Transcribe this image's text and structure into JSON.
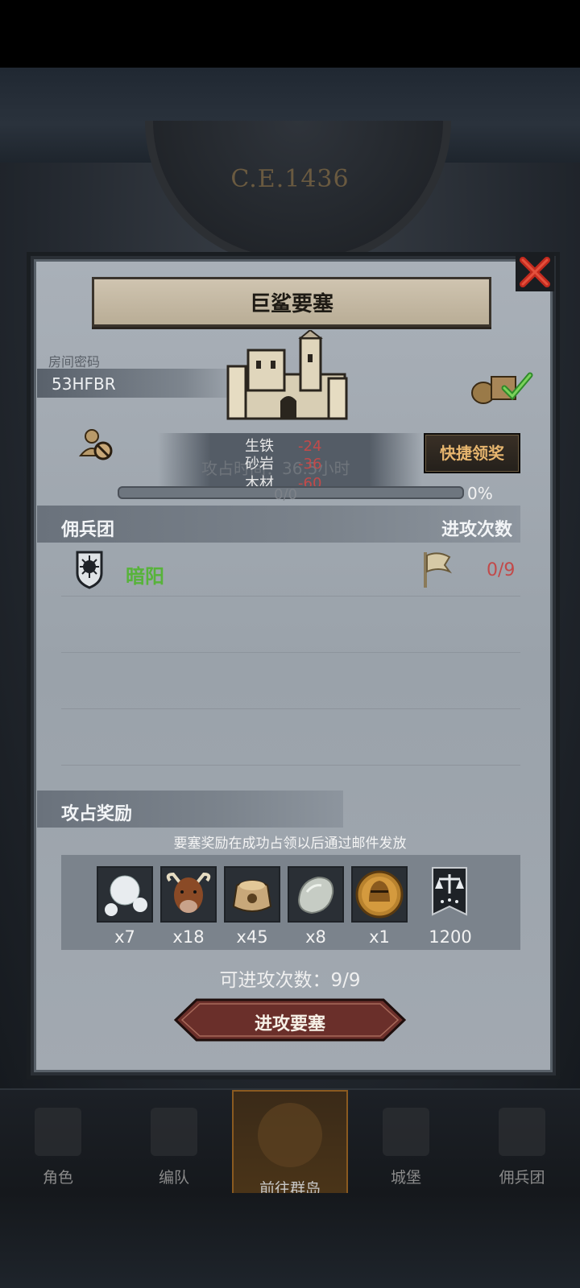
{
  "era_label": "C.E.1436",
  "modal": {
    "title": "巨鲨要塞",
    "room_label": "房间密码",
    "room_code": "53HFBR",
    "timer_text": "攻占时间：36.5小时",
    "resources": [
      {
        "name": "生铁",
        "value": "-24"
      },
      {
        "name": "砂岩",
        "value": "-36"
      },
      {
        "name": "木材",
        "value": "-60"
      }
    ],
    "quick_claim": "快捷领奖",
    "progress": {
      "text": "0/0",
      "percent": "0%",
      "fill": 0
    }
  },
  "mercenary": {
    "section_label": "佣兵团",
    "attacks_label": "进攻次数",
    "name": "暗阳",
    "attack_count": "0/9"
  },
  "rewards": {
    "section_label": "攻占奖励",
    "note": "要塞奖励在成功占领以后通过邮件发放",
    "items": [
      {
        "icon": "pearl-icon",
        "count": "x7"
      },
      {
        "icon": "cattle-icon",
        "count": "x18"
      },
      {
        "icon": "grain-sack-icon",
        "count": "x45"
      },
      {
        "icon": "stone-icon",
        "count": "x8"
      },
      {
        "icon": "knight-helmet-coin-icon",
        "count": "x1"
      },
      {
        "icon": "justice-banner-icon",
        "count": "1200"
      }
    ],
    "attempts_text": "可进攻次数：9/9",
    "attack_button": "进攻要塞"
  },
  "nav": {
    "items": [
      {
        "label": "角色"
      },
      {
        "label": "编队"
      },
      {
        "label": "前往群岛"
      },
      {
        "label": "城堡"
      },
      {
        "label": "佣兵团"
      }
    ]
  },
  "colors": {
    "negative": "#c24a4a",
    "merc_name": "#57b33a",
    "quick_claim_text": "#e6b56e"
  }
}
